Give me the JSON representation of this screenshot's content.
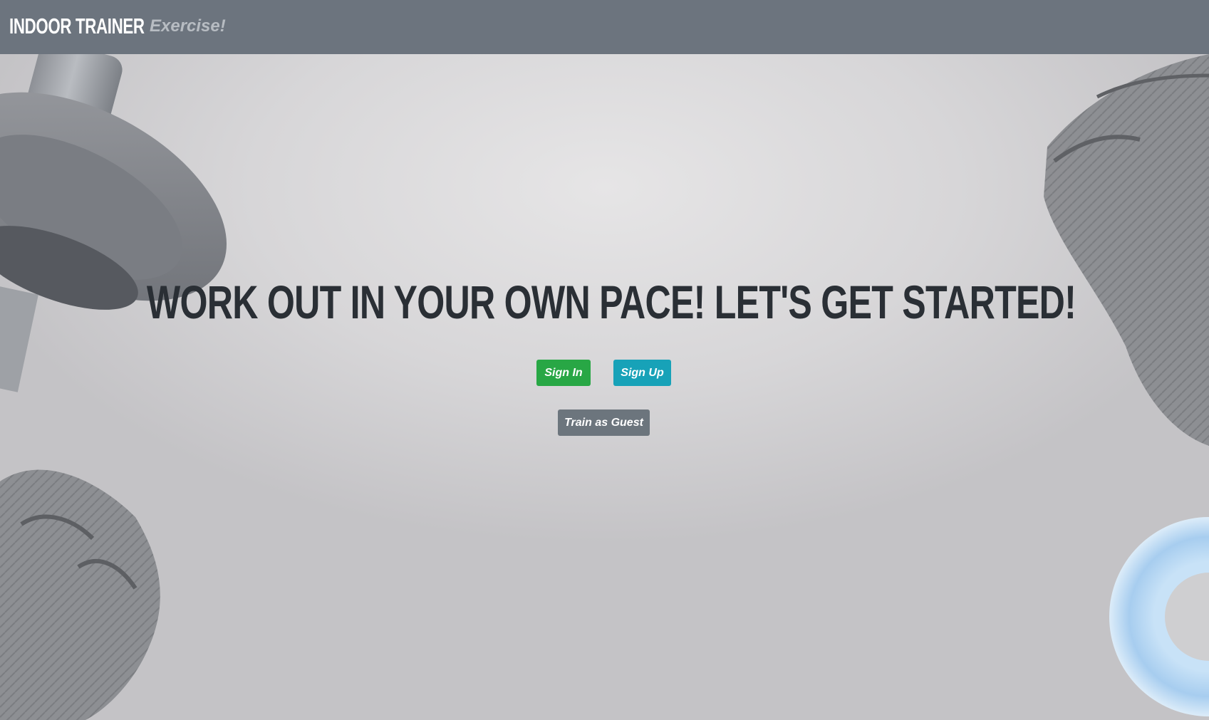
{
  "navbar": {
    "brand": "INDOOR TRAINER",
    "link": "Exercise!",
    "color": "#6c747e"
  },
  "hero": {
    "headline": "WORK OUT IN YOUR OWN PACE! LET'S GET STARTED!",
    "buttons": {
      "sign_in": "Sign In",
      "sign_up": "Sign Up",
      "guest": "Train as Guest"
    },
    "colors": {
      "sign_in": "#28a745",
      "sign_up": "#17a2b8",
      "guest": "#6c757d",
      "headline": "#2a2f35"
    },
    "decorations": [
      "dumbbell-image",
      "glove-image",
      "glove-image",
      "ring-image"
    ]
  }
}
